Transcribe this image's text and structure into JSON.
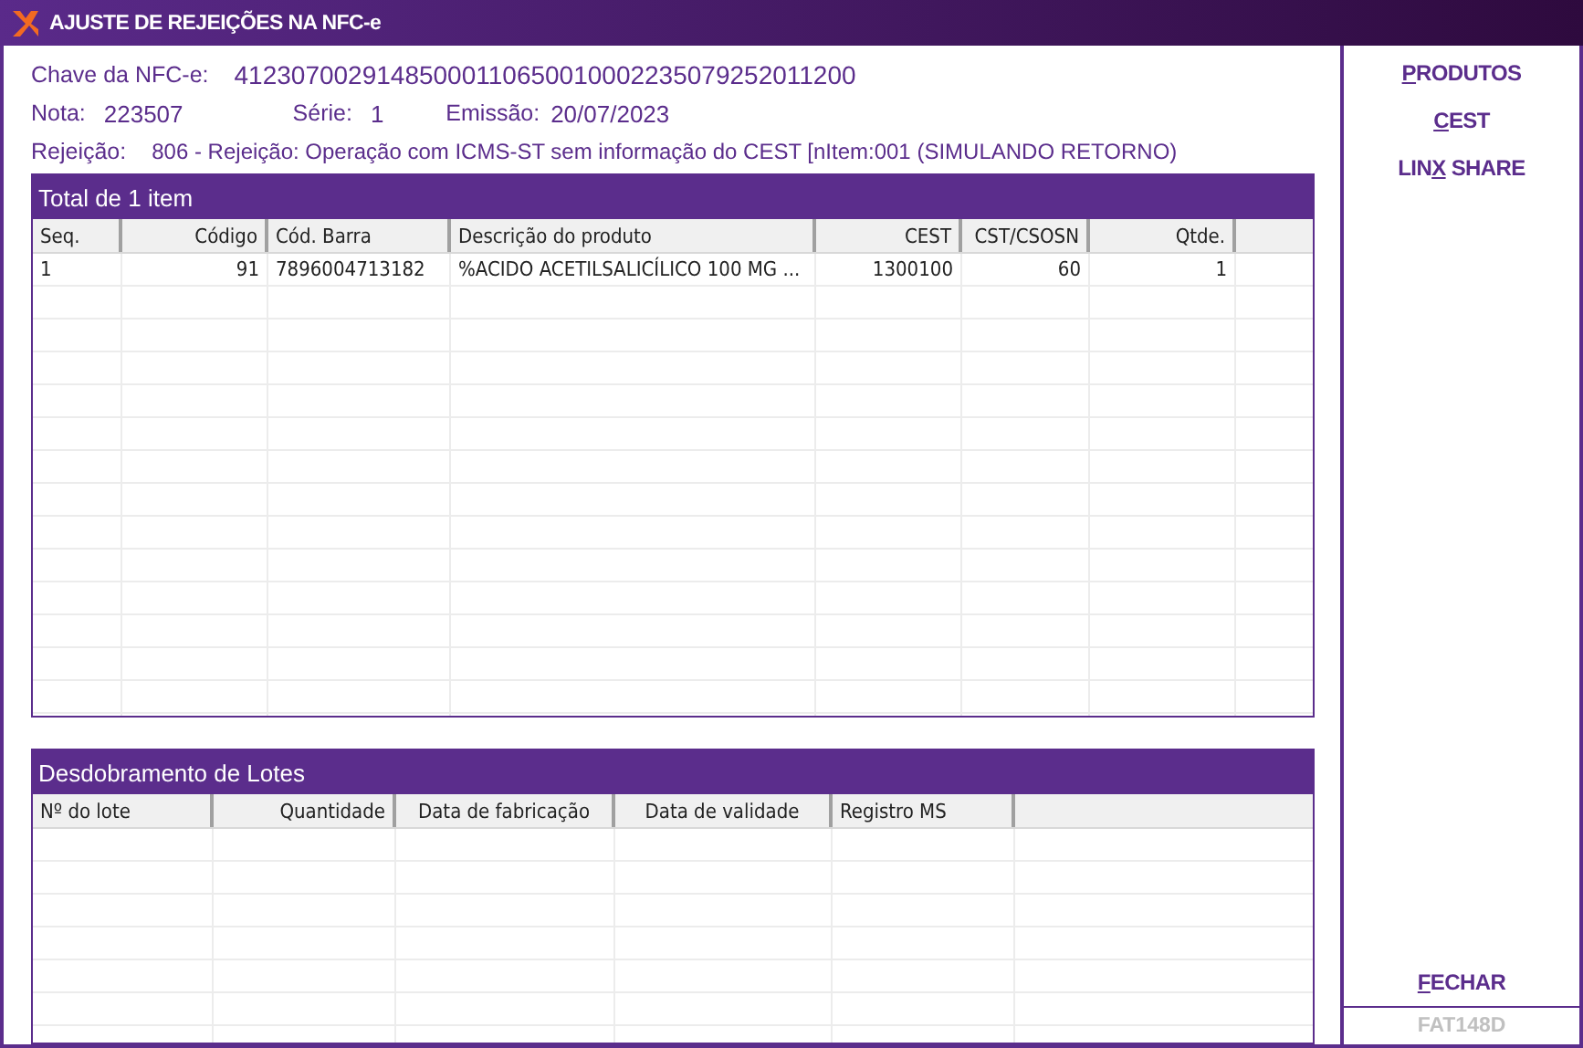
{
  "window": {
    "title": "AJUSTE DE REJEIÇÕES NA NFC-e"
  },
  "info": {
    "chave_label": "Chave da NFC-e:",
    "chave": "41230700291485000110650010002235079252011200",
    "nota_label": "Nota:",
    "nota": "223507",
    "serie_label": "Série:",
    "serie": "1",
    "emissao_label": "Emissão:",
    "emissao": "20/07/2023",
    "rejeicao_label": "Rejeição:",
    "rejeicao": "806 - Rejeição: Operação com ICMS-ST sem informação do CEST [nItem:001 (SIMULANDO RETORNO)"
  },
  "items_table": {
    "title": "Total de 1 item",
    "columns": [
      "Seq.",
      "Código",
      "Cód. Barra",
      "Descrição do produto",
      "CEST",
      "CST/CSOSN",
      "Qtde."
    ],
    "rows": [
      [
        "1",
        "91",
        "7896004713182",
        "%ACIDO ACETILSALICÍLICO 100 MG ...",
        "1300100",
        "60",
        "1"
      ]
    ]
  },
  "lots_table": {
    "title": "Desdobramento de Lotes",
    "columns": [
      "Nº do lote",
      "Quantidade",
      "Data de fabricação",
      "Data de validade",
      "Registro MS"
    ]
  },
  "side_buttons": [
    {
      "label": "PRODUTOS"
    },
    {
      "label": "CEST"
    },
    {
      "label": "LINX SHARE"
    }
  ],
  "close_button": {
    "label": "FECHAR"
  },
  "form_code": "FAT148D"
}
